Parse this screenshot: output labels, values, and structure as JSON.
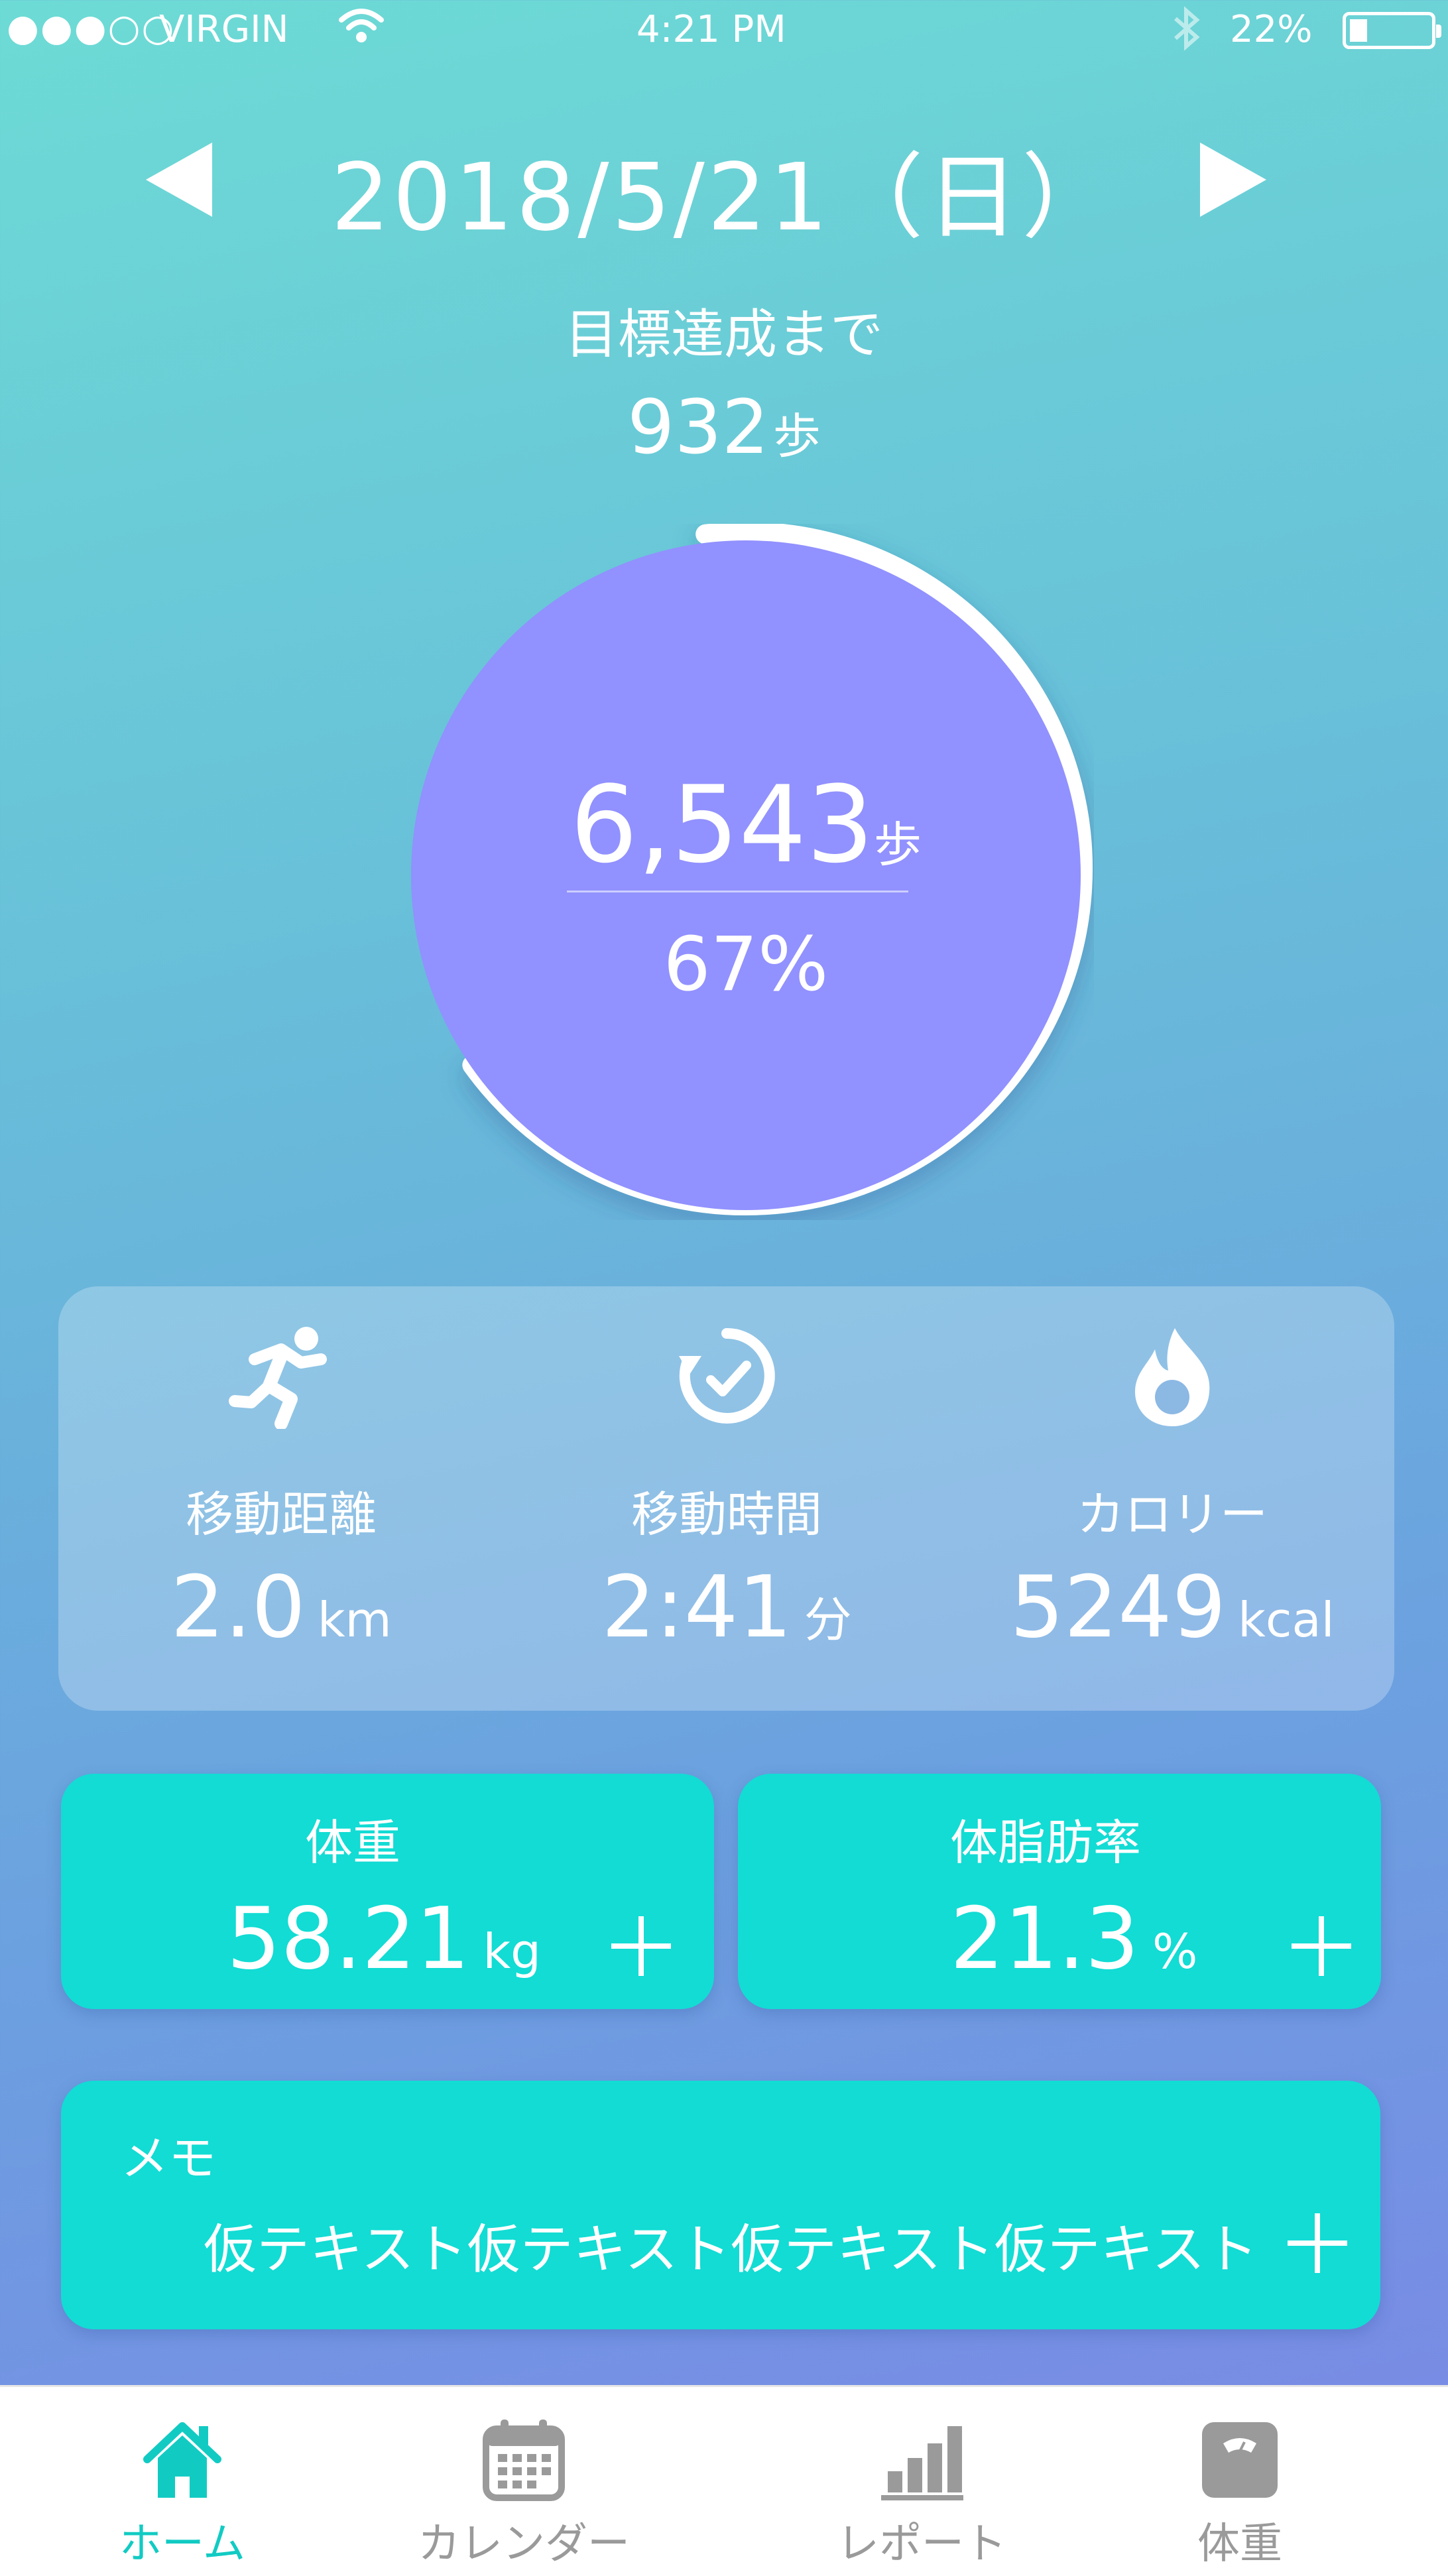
{
  "status_bar": {
    "signal": "●●●○○",
    "carrier": "VIRGIN",
    "time": "4:21 PM",
    "battery_percent": "22%",
    "battery_level": 0.22
  },
  "date_nav": {
    "date": "2018/5/21（日）",
    "prev_icon": "triangle-left-icon",
    "next_icon": "triangle-right-icon"
  },
  "goal": {
    "label": "目標達成まで",
    "remaining": "932",
    "unit": "歩"
  },
  "progress": {
    "steps": "6,543",
    "unit": "歩",
    "percent_label": "67%",
    "fraction": 0.67
  },
  "stats": [
    {
      "icon": "running-person-icon",
      "label": "移動距離",
      "value": "2.0",
      "unit": "km"
    },
    {
      "icon": "timer-icon",
      "label": "移動時間",
      "value": "2:41",
      "unit": "分"
    },
    {
      "icon": "flame-icon",
      "label": "カロリー",
      "value": "5249",
      "unit": "kcal"
    }
  ],
  "weight": {
    "label": "体重",
    "value": "58.21",
    "unit": "kg"
  },
  "body_fat": {
    "label": "体脂肪率",
    "value": "21.3",
    "unit": "%"
  },
  "memo": {
    "label": "メモ",
    "text": "仮テキスト仮テキスト仮テキスト仮テキスト"
  },
  "tabs": [
    {
      "label": "ホーム",
      "icon": "home-icon",
      "active": true
    },
    {
      "label": "カレンダー",
      "icon": "calendar-icon",
      "active": false
    },
    {
      "label": "レポート",
      "icon": "bar-chart-icon",
      "active": false
    },
    {
      "label": "体重",
      "icon": "scale-icon",
      "active": false
    }
  ],
  "colors": {
    "circle_fill": "#9191ff",
    "card_teal": "#12dcd4",
    "tab_active": "#11cbc3",
    "tab_inactive": "#9a9a9a"
  }
}
